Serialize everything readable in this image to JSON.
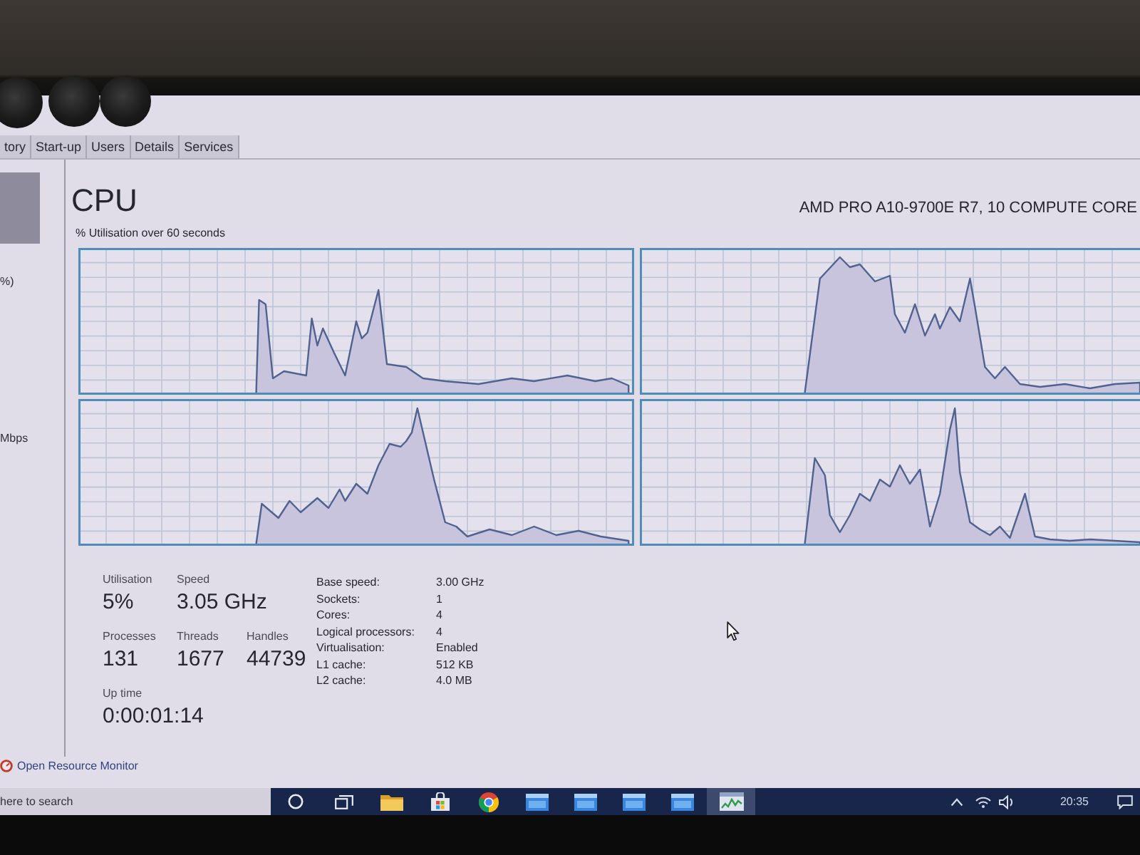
{
  "tabs": [
    {
      "label": "tory",
      "selected": false
    },
    {
      "label": "Start-up",
      "selected": false
    },
    {
      "label": "Users",
      "selected": false
    },
    {
      "label": "Details",
      "selected": false
    },
    {
      "label": "Services",
      "selected": false
    }
  ],
  "sidebar": {
    "items": [
      {
        "selected": true
      },
      {
        "text": "%)",
        "selected": false
      },
      {
        "text": "Mbps",
        "selected": false
      }
    ]
  },
  "header": {
    "title": "CPU",
    "processor": "AMD PRO A10-9700E R7, 10 COMPUTE CORE",
    "graph_caption": "% Utilisation over 60 seconds"
  },
  "stat_rows": [
    [
      {
        "label": "Utilisation",
        "value": "5%"
      },
      {
        "label": "Speed",
        "value": "3.05 GHz"
      }
    ],
    [
      {
        "label": "Processes",
        "value": "131"
      },
      {
        "label": "Threads",
        "value": "1677"
      },
      {
        "label": "Handles",
        "value": "44739"
      }
    ],
    [
      {
        "label": "Up time",
        "value": "0:00:01:14"
      }
    ]
  ],
  "details": [
    {
      "label": "Base speed:",
      "value": "3.00 GHz"
    },
    {
      "label": "Sockets:",
      "value": "1"
    },
    {
      "label": "Cores:",
      "value": "4"
    },
    {
      "label": "Logical processors:",
      "value": "4"
    },
    {
      "label": "Virtualisation:",
      "value": "Enabled"
    },
    {
      "label": "L1 cache:",
      "value": "512 KB"
    },
    {
      "label": "L2 cache:",
      "value": "4.0 MB"
    }
  ],
  "footer": {
    "link": "Open Resource Monitor"
  },
  "taskbar": {
    "search": {
      "placeholder": "here to search"
    },
    "apps": [
      {
        "kind": "ring",
        "active": false
      },
      {
        "kind": "task-view",
        "active": false
      },
      {
        "kind": "folder",
        "active": false
      },
      {
        "kind": "store",
        "active": false
      },
      {
        "kind": "browser",
        "active": false
      },
      {
        "kind": "window",
        "active": false
      },
      {
        "kind": "window",
        "active": false
      },
      {
        "kind": "window",
        "active": false
      },
      {
        "kind": "window",
        "active": false
      },
      {
        "kind": "task-manager",
        "active": true
      }
    ],
    "clock": "20:35"
  }
}
